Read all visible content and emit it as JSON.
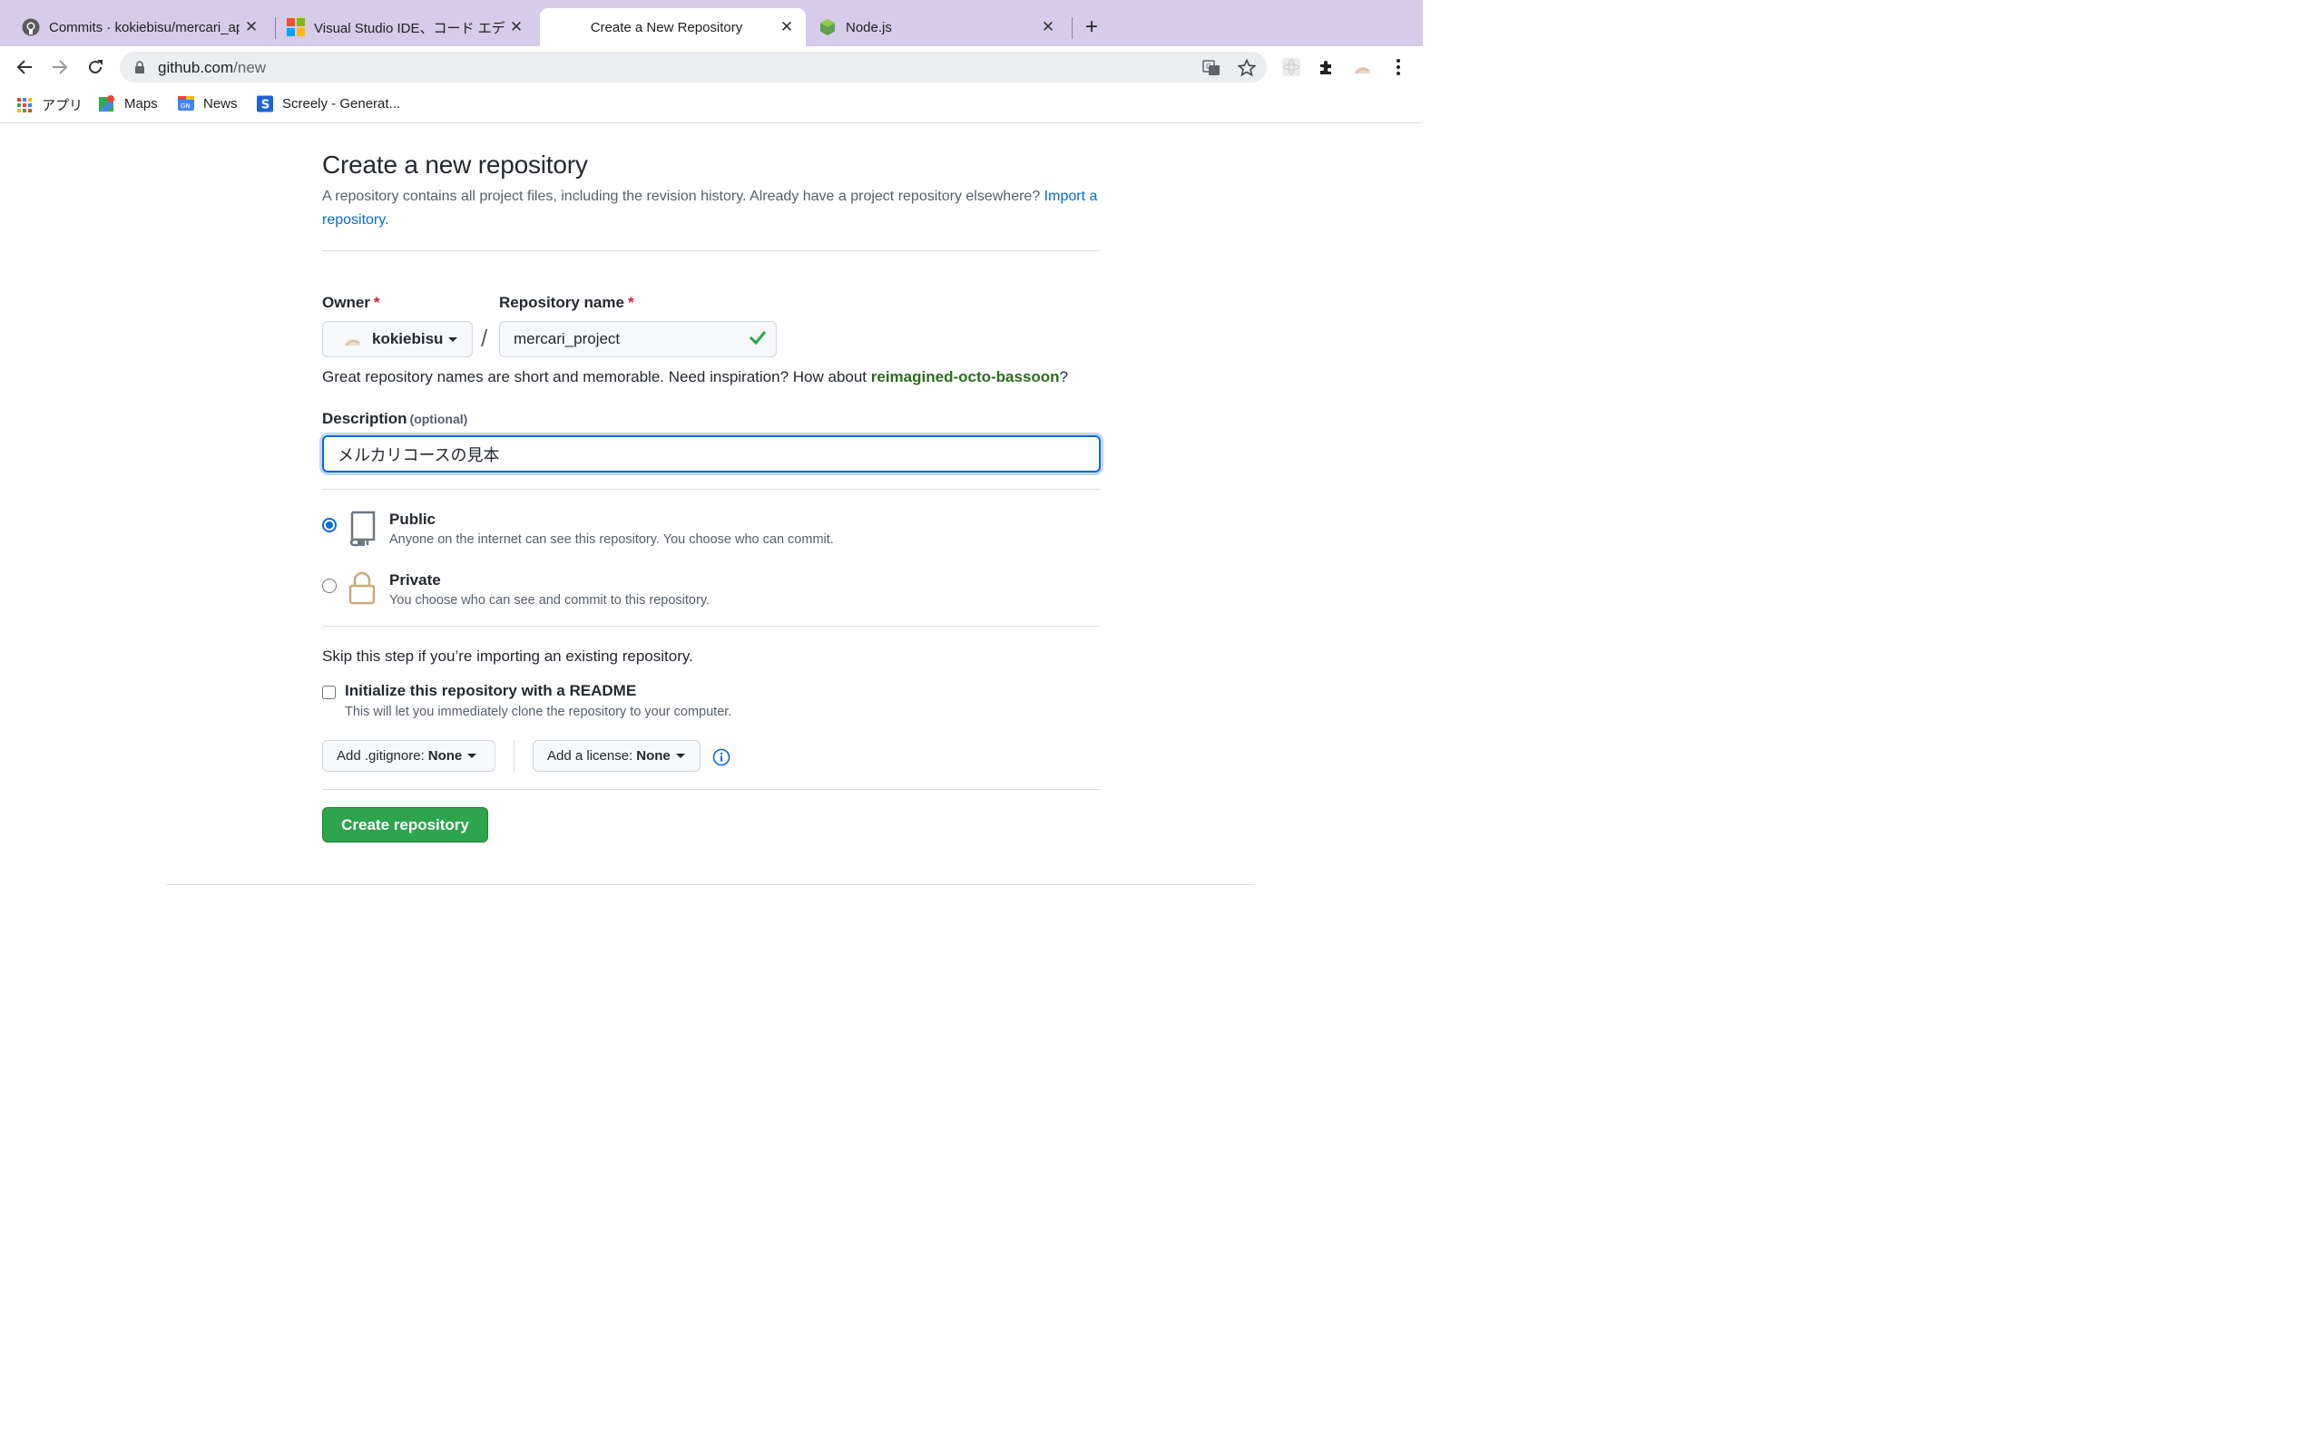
{
  "browser": {
    "tabs": [
      {
        "title": "Commits · kokiebisu/mercari_app",
        "icon": "github-icon",
        "active": false
      },
      {
        "title": "Visual Studio IDE、コード エディター",
        "icon": "microsoft-icon",
        "active": false
      },
      {
        "title": "Create a New Repository",
        "icon": "github-icon",
        "active": true
      },
      {
        "title": "Node.js",
        "icon": "nodejs-icon",
        "active": false
      }
    ],
    "close_glyph": "✕",
    "new_tab_glyph": "+",
    "url_host": "github.com",
    "url_path": "/new",
    "bookmarks": [
      {
        "label": "アプリ",
        "icon": "apps-grid-icon"
      },
      {
        "label": "Maps",
        "icon": "maps-icon"
      },
      {
        "label": "News",
        "icon": "news-icon"
      },
      {
        "label": "Screely - Generat...",
        "icon": "screely-icon"
      }
    ],
    "colors": {
      "tabbar": "#d6cbe8",
      "omnibox": "#ebedf0"
    }
  },
  "form": {
    "title": "Create a new repository",
    "subtitle": "A repository contains all project files, including the revision history. Already have a project repository elsewhere?",
    "import_link": "Import a repository.",
    "owner_label": "Owner",
    "required_mark": "*",
    "owner_value": "kokiebisu",
    "repo_label": "Repository name",
    "repo_value": "mercari_project",
    "slash": "/",
    "hint_prefix": "Great repository names are short and memorable. Need inspiration? How about",
    "hint_suggestion": "reimagined-octo-bassoon",
    "hint_suffix": "?",
    "description_label": "Description",
    "description_optional": "(optional)",
    "description_value": "メルカリコースの見本",
    "visibility": [
      {
        "title": "Public",
        "desc": "Anyone on the internet can see this repository. You choose who can commit.",
        "selected": true,
        "icon": "repo-icon"
      },
      {
        "title": "Private",
        "desc": "You choose who can see and commit to this repository.",
        "selected": false,
        "icon": "lock-icon"
      }
    ],
    "skip_text": "Skip this step if you’re importing an existing repository.",
    "readme_title": "Initialize this repository with a README",
    "readme_desc": "This will let you immediately clone the repository to your computer.",
    "readme_checked": false,
    "gitignore_label": "Add .gitignore:",
    "gitignore_value": "None",
    "license_label": "Add a license:",
    "license_value": "None",
    "create_button": "Create repository",
    "colors": {
      "primary": "#2da44e",
      "link": "#0969da",
      "required": "#cf222e",
      "suggestion": "#2c6b1f"
    }
  }
}
